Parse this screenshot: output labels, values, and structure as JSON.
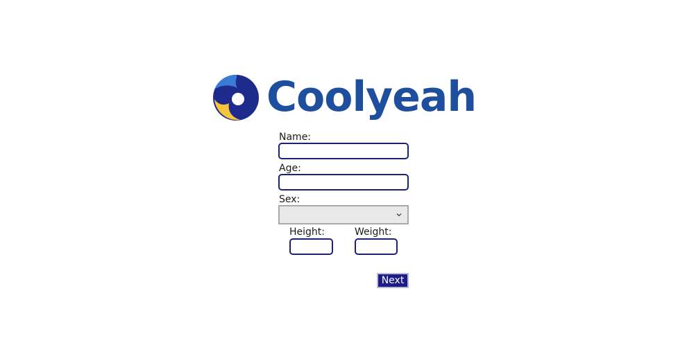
{
  "brand": {
    "name": "Coolyeah",
    "logo_icon": "coolyeah-logo-icon",
    "colors": {
      "text": "#1d4f9e",
      "mark_dark": "#1e2a8c",
      "mark_light": "#3a7bd5",
      "mark_yellow": "#f5c63c"
    }
  },
  "form": {
    "name_label": "Name:",
    "name_value": "",
    "age_label": "Age:",
    "age_value": "",
    "sex_label": "Sex:",
    "sex_selected": "",
    "sex_icon": "chevron-down-icon",
    "height_label": "Height:",
    "height_value": "",
    "weight_label": "Weight:",
    "weight_value": "",
    "next_label": "Next"
  },
  "colors": {
    "input_border": "#1f1f7a",
    "button_bg": "#1e1c87",
    "select_bg": "#e9e9e9"
  }
}
